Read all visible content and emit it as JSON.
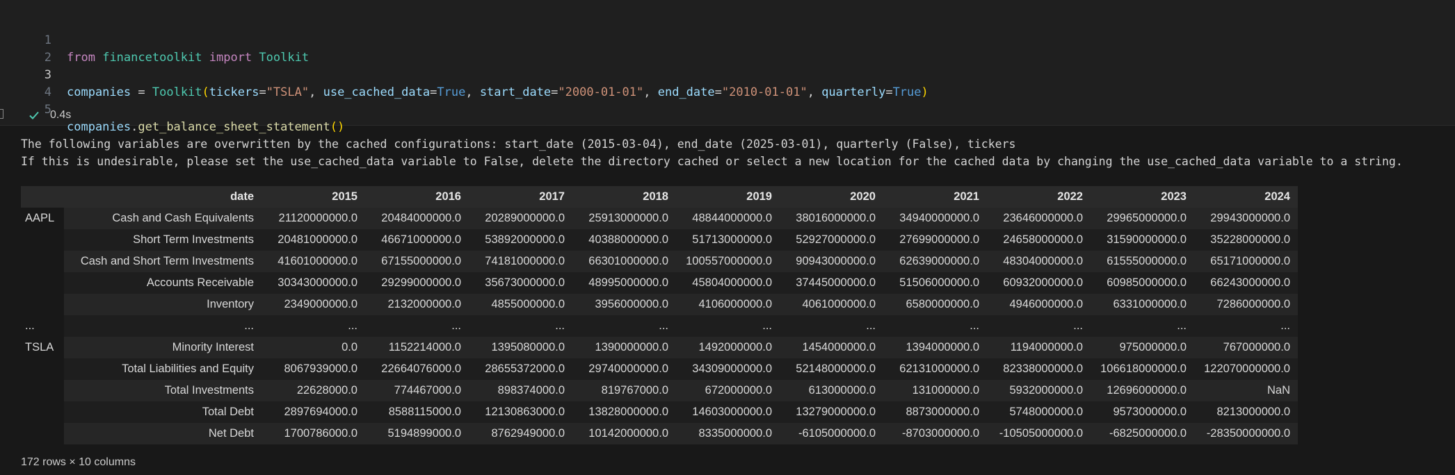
{
  "code": {
    "lines": [
      {
        "n": "1"
      },
      {
        "n": "2"
      },
      {
        "n": "3"
      },
      {
        "n": "4"
      },
      {
        "n": "5"
      }
    ],
    "l1": {
      "kw1": "from",
      "mod": "financetoolkit",
      "kw2": "import",
      "cls": "Toolkit"
    },
    "l3": {
      "var": "companies",
      "eq": "=",
      "cls": "Toolkit",
      "open": "(",
      "a1": "tickers",
      "v1": "\"TSLA\"",
      "a2": "use_cached_data",
      "v2": "True",
      "a3": "start_date",
      "v3": "\"2000-01-01\"",
      "a4": "end_date",
      "v4": "\"2010-01-01\"",
      "a5": "quarterly",
      "v5": "True",
      "close": ")"
    },
    "l5": {
      "var": "companies",
      "fn": "get_balance_sheet_statement",
      "parens": "()"
    }
  },
  "status": {
    "time": "0.4s",
    "icon": "check-icon",
    "color": "#4ec9b0"
  },
  "output": {
    "warning_1": "The following variables are overwritten by the cached configurations: start_date (2015-03-04), end_date (2025-03-01), quarterly (False), tickers",
    "warning_2": "If this is undesirable, please set the use_cached_data variable to False, delete the directory cached or select a new location for the cached data by changing the use_cached_data variable to a string."
  },
  "table": {
    "index_header": "date",
    "columns": [
      "2015",
      "2016",
      "2017",
      "2018",
      "2019",
      "2020",
      "2021",
      "2022",
      "2023",
      "2024"
    ],
    "rows": [
      {
        "t": "AAPL",
        "label": "Cash and Cash Equivalents",
        "v": [
          "21120000000.0",
          "20484000000.0",
          "20289000000.0",
          "25913000000.0",
          "48844000000.0",
          "38016000000.0",
          "34940000000.0",
          "23646000000.0",
          "29965000000.0",
          "29943000000.0"
        ]
      },
      {
        "t": "",
        "label": "Short Term Investments",
        "v": [
          "20481000000.0",
          "46671000000.0",
          "53892000000.0",
          "40388000000.0",
          "51713000000.0",
          "52927000000.0",
          "27699000000.0",
          "24658000000.0",
          "31590000000.0",
          "35228000000.0"
        ]
      },
      {
        "t": "",
        "label": "Cash and Short Term Investments",
        "v": [
          "41601000000.0",
          "67155000000.0",
          "74181000000.0",
          "66301000000.0",
          "100557000000.0",
          "90943000000.0",
          "62639000000.0",
          "48304000000.0",
          "61555000000.0",
          "65171000000.0"
        ]
      },
      {
        "t": "",
        "label": "Accounts Receivable",
        "v": [
          "30343000000.0",
          "29299000000.0",
          "35673000000.0",
          "48995000000.0",
          "45804000000.0",
          "37445000000.0",
          "51506000000.0",
          "60932000000.0",
          "60985000000.0",
          "66243000000.0"
        ]
      },
      {
        "t": "",
        "label": "Inventory",
        "v": [
          "2349000000.0",
          "2132000000.0",
          "4855000000.0",
          "3956000000.0",
          "4106000000.0",
          "4061000000.0",
          "6580000000.0",
          "4946000000.0",
          "6331000000.0",
          "7286000000.0"
        ]
      },
      {
        "t": "...",
        "label": "...",
        "v": [
          "...",
          "...",
          "...",
          "...",
          "...",
          "...",
          "...",
          "...",
          "...",
          "..."
        ]
      },
      {
        "t": "TSLA",
        "label": "Minority Interest",
        "v": [
          "0.0",
          "1152214000.0",
          "1395080000.0",
          "1390000000.0",
          "1492000000.0",
          "1454000000.0",
          "1394000000.0",
          "1194000000.0",
          "975000000.0",
          "767000000.0"
        ]
      },
      {
        "t": "",
        "label": "Total Liabilities and Equity",
        "v": [
          "8067939000.0",
          "22664076000.0",
          "28655372000.0",
          "29740000000.0",
          "34309000000.0",
          "52148000000.0",
          "62131000000.0",
          "82338000000.0",
          "106618000000.0",
          "122070000000.0"
        ]
      },
      {
        "t": "",
        "label": "Total Investments",
        "v": [
          "22628000.0",
          "774467000.0",
          "898374000.0",
          "819767000.0",
          "672000000.0",
          "613000000.0",
          "131000000.0",
          "5932000000.0",
          "12696000000.0",
          "NaN"
        ]
      },
      {
        "t": "",
        "label": "Total Debt",
        "v": [
          "2897694000.0",
          "8588115000.0",
          "12130863000.0",
          "13828000000.0",
          "14603000000.0",
          "13279000000.0",
          "8873000000.0",
          "5748000000.0",
          "9573000000.0",
          "8213000000.0"
        ]
      },
      {
        "t": "",
        "label": "Net Debt",
        "v": [
          "1700786000.0",
          "5194899000.0",
          "8762949000.0",
          "10142000000.0",
          "8335000000.0",
          "-6105000000.0",
          "-8703000000.0",
          "-10505000000.0",
          "-6825000000.0",
          "-28350000000.0"
        ]
      }
    ],
    "footer": "172 rows × 10 columns"
  }
}
